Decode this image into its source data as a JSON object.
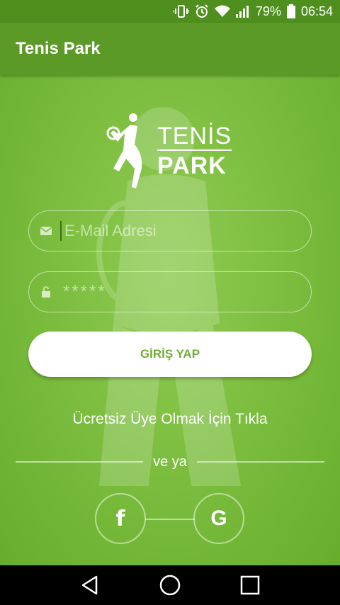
{
  "status_bar": {
    "battery": "79%",
    "time": "06:54",
    "icons": [
      "vibrate-icon",
      "alarm-icon",
      "wifi-icon",
      "signal-icon",
      "battery-icon"
    ]
  },
  "app_bar": {
    "title": "Tenis Park"
  },
  "logo": {
    "line1": "TENİS",
    "line2": "PARK"
  },
  "login": {
    "email_placeholder": "E-Mail Adresi",
    "password_placeholder": "*****",
    "submit_label": "GİRİŞ YAP"
  },
  "register_link": "Ücretsiz Üye Olmak İçin Tıkla",
  "divider_text": "ve ya",
  "social": {
    "facebook_label": "f",
    "google_label": "G"
  },
  "colors": {
    "appbar": "#5c9a28",
    "statusbar": "#4f8f1e",
    "background": "#79bb3c",
    "button_text": "#6fae33"
  }
}
